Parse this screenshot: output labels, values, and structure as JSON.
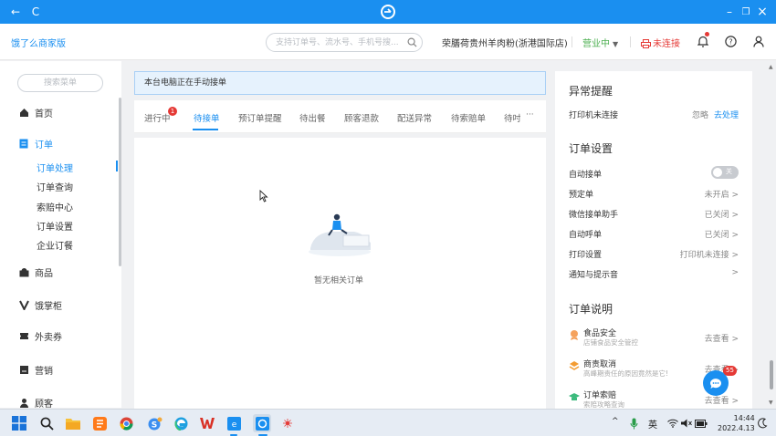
{
  "titlebar": {
    "back": "←",
    "reload": "C",
    "minimize": "–",
    "restore": "❐",
    "close": "×"
  },
  "header": {
    "brand": "饿了么商家版",
    "search_placeholder": "支持订单号、流水号、手机号搜...",
    "shop_name": "荣膳荷贵州羊肉粉(浙港国际店)",
    "status": "营业中",
    "printer_status": "未连接"
  },
  "sidebar": {
    "search": "搜索菜单",
    "nav": [
      {
        "label": "首页",
        "icon": "home-icon"
      },
      {
        "label": "订单",
        "icon": "order-icon"
      },
      {
        "label": "商品",
        "icon": "goods-icon"
      },
      {
        "label": "饿掌柜",
        "icon": "v-icon"
      },
      {
        "label": "外卖券",
        "icon": "coupon-icon"
      },
      {
        "label": "营销",
        "icon": "marketing-icon"
      },
      {
        "label": "顾客",
        "icon": "customer-icon"
      }
    ],
    "order_sub": [
      "订单处理",
      "订单查询",
      "索赔中心",
      "订单设置",
      "企业订餐"
    ]
  },
  "main": {
    "notice": "本台电脑正在手动接单",
    "tabs": [
      "进行中",
      "待接单",
      "预订单提醒",
      "待出餐",
      "顾客退款",
      "配送异常",
      "待索赔单",
      "待吋"
    ],
    "tab_badge": "1",
    "tab_more": "···",
    "empty_text": "暂无相关订单"
  },
  "right": {
    "alert_title": "异常提醒",
    "alert_row": {
      "label": "打印机未连接",
      "ignore": "忽略",
      "handle": "去处理"
    },
    "settings_title": "订单设置",
    "settings": [
      {
        "label": "自动接单",
        "value": ""
      },
      {
        "label": "预定单",
        "value": "未开启 >"
      },
      {
        "label": "微信接单助手",
        "value": "已关闭 >"
      },
      {
        "label": "自动呼单",
        "value": "已关闭 >"
      },
      {
        "label": "打印设置",
        "value": "打印机未连接 >"
      },
      {
        "label": "通知与提示音",
        "value": ">"
      }
    ],
    "toggle_label": "关",
    "toggle_on": false,
    "info_title": "订单说明",
    "info": [
      {
        "title": "食品安全",
        "sub": "店铺食品安全管控",
        "action": "去查看 >"
      },
      {
        "title": "商责取消",
        "sub": "高峰期责任的原因竟然是它!",
        "action": "去查看 >"
      },
      {
        "title": "订单索赔",
        "sub": "索赔攻略查询",
        "action": "去查看 >"
      }
    ],
    "chat_badge": "55"
  },
  "taskbar": {
    "ime": "英",
    "time": "14:44",
    "date": "2022.4.13"
  },
  "colors": {
    "accent": "#1a8ff0",
    "danger": "#e53935",
    "online": "#4caf50"
  }
}
